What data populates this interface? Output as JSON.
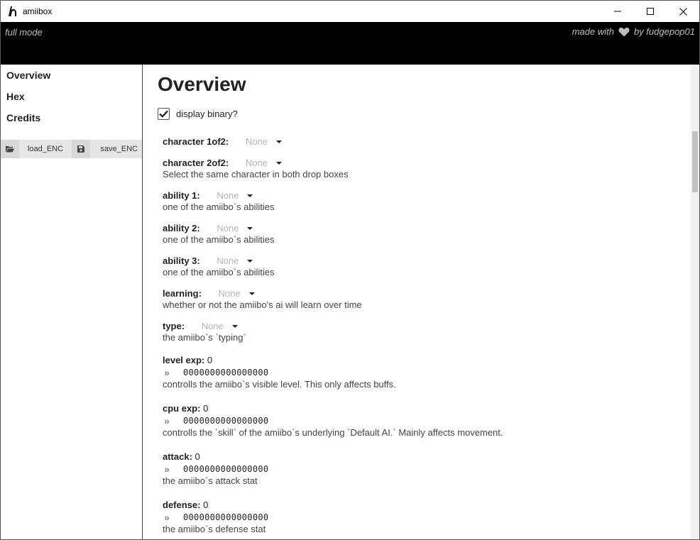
{
  "window": {
    "title": "amiibox",
    "icon": "amiibo-logo-icon"
  },
  "header": {
    "mode": "full mode",
    "made_with": "made with",
    "by": "by fudgepop01"
  },
  "sidebar": {
    "items": [
      {
        "label": "Overview"
      },
      {
        "label": "Hex"
      },
      {
        "label": "Credits"
      }
    ],
    "load_label": "load_ENC",
    "save_label": "save_ENC"
  },
  "main": {
    "title": "Overview",
    "display_binary_label": "display binary?",
    "display_binary_checked": true,
    "character1": {
      "label": "character 1of2:",
      "value": "None"
    },
    "character2": {
      "label": "character 2of2:",
      "value": "None",
      "desc": "Select the same character in both drop boxes"
    },
    "ability1": {
      "label": "ability 1:",
      "value": "None",
      "desc": "one of the amiibo`s abilities"
    },
    "ability2": {
      "label": "ability 2:",
      "value": "None",
      "desc": "one of the amiibo`s abilities"
    },
    "ability3": {
      "label": "ability 3:",
      "value": "None",
      "desc": "one of the amiibo`s abilities"
    },
    "learning": {
      "label": "learning:",
      "value": "None",
      "desc": "whether or not the amiibo's ai will learn over time"
    },
    "type": {
      "label": "type:",
      "value": "None",
      "desc": "the amiibo`s `typing`"
    },
    "level_exp": {
      "label": "level exp:",
      "value": "0",
      "binary": "0000000000000000",
      "desc": "controlls the amiibo`s visible level. This only affects buffs."
    },
    "cpu_exp": {
      "label": "cpu exp:",
      "value": "0",
      "binary": "0000000000000000",
      "desc": "controlls the `skill` of the amiibo`s underlying `Default AI.` Mainly affects movement."
    },
    "attack": {
      "label": "attack:",
      "value": "0",
      "binary": "0000000000000000",
      "desc": "the amiibo`s attack stat"
    },
    "defense": {
      "label": "defense:",
      "value": "0",
      "binary": "0000000000000000",
      "desc": "the amiibo`s defense stat"
    }
  }
}
